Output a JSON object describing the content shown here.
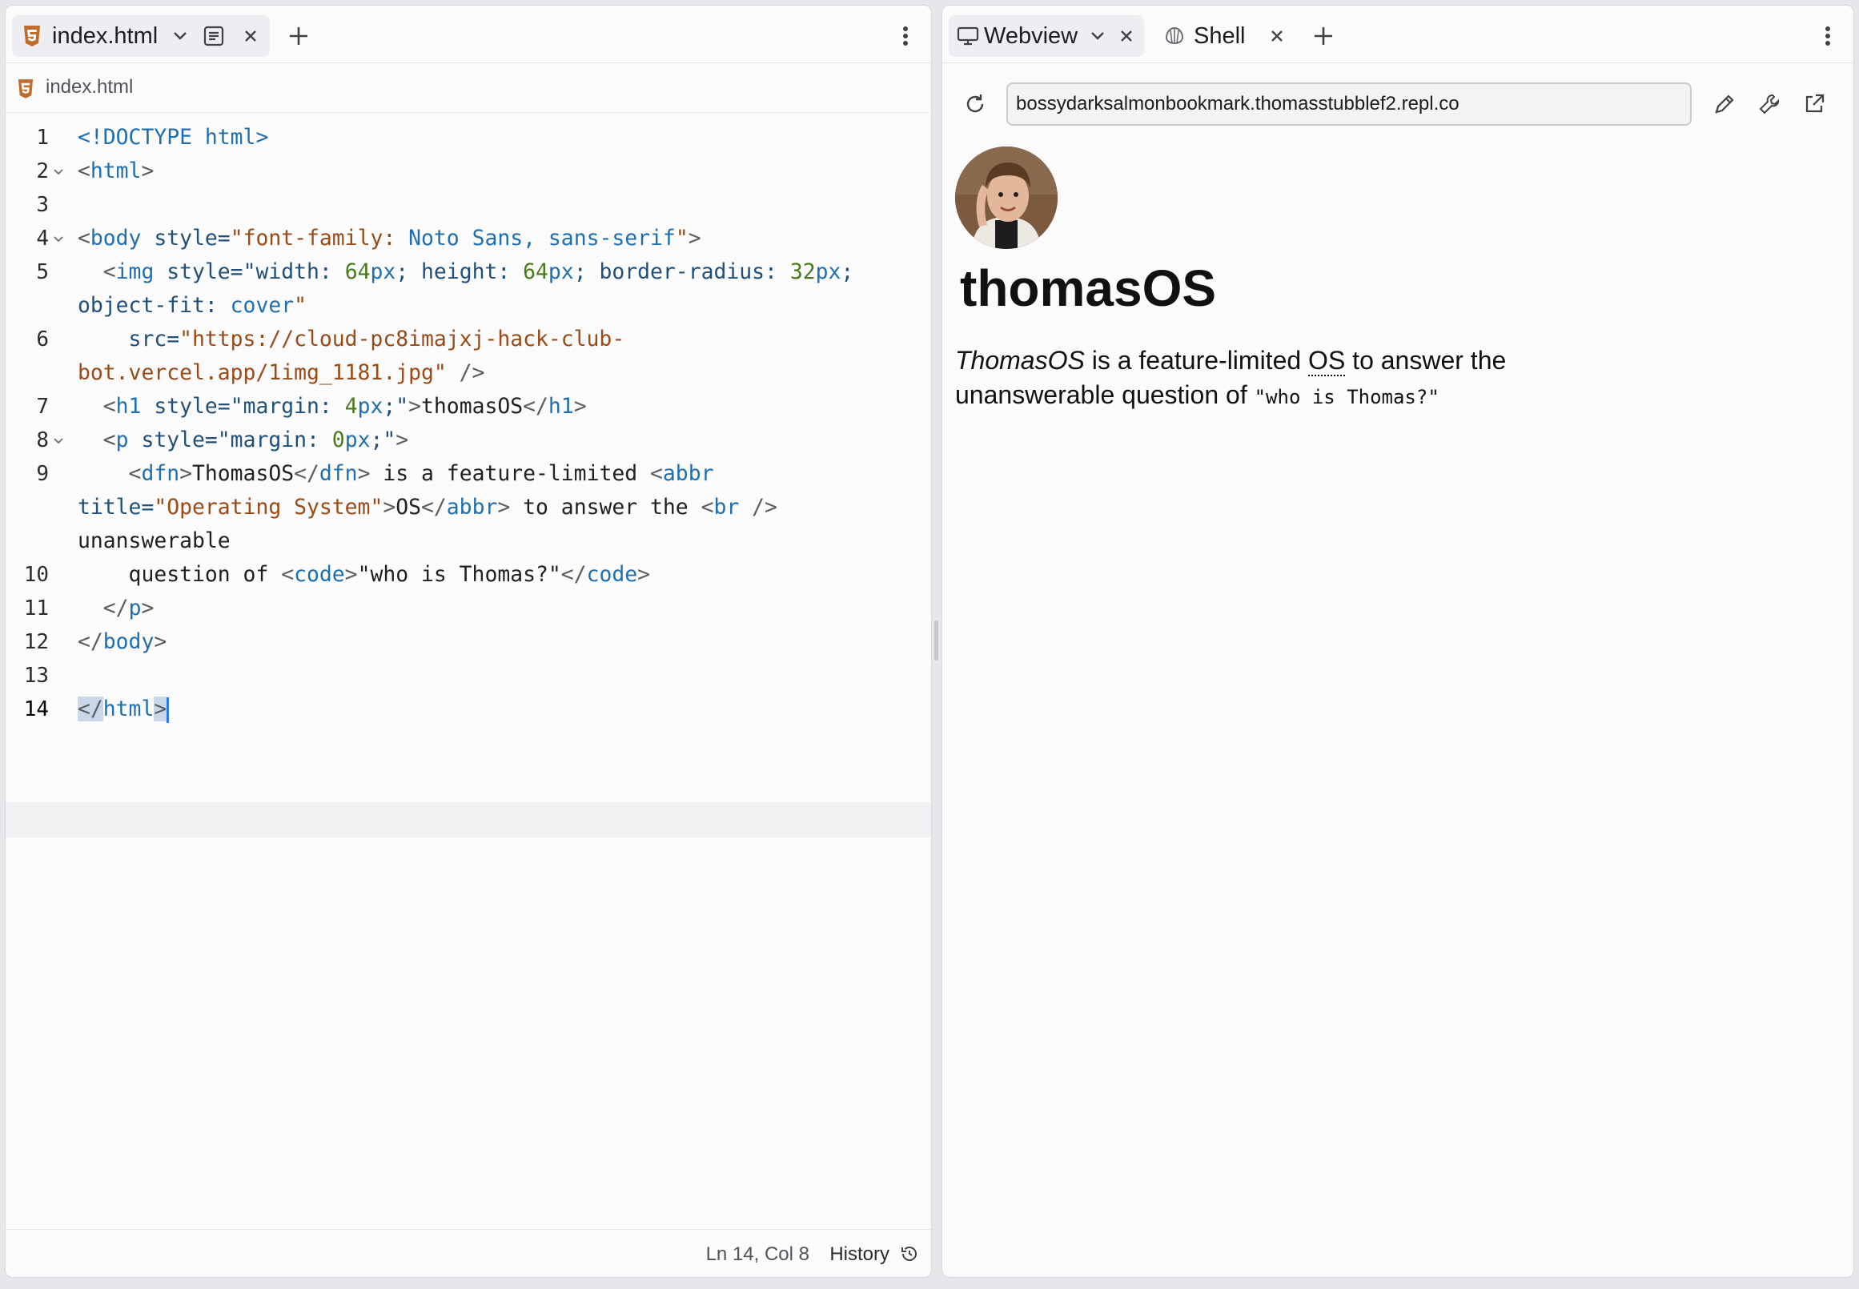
{
  "editor": {
    "tab_label": "index.html",
    "breadcrumb": "index.html",
    "lines": [
      {
        "num": "1"
      },
      {
        "num": "2"
      },
      {
        "num": "3"
      },
      {
        "num": "4"
      },
      {
        "num": "5"
      },
      {
        "num": "6"
      },
      {
        "num": "7"
      },
      {
        "num": "8"
      },
      {
        "num": "9"
      },
      {
        "num": "10"
      },
      {
        "num": "11"
      },
      {
        "num": "12"
      },
      {
        "num": "13"
      },
      {
        "num": "14"
      }
    ],
    "code": {
      "l1_doctype": "<!DOCTYPE html>",
      "l2_open": "<",
      "l2_tag": "html",
      "l2_close": ">",
      "l4_open": "<",
      "l4_tag": "body",
      "l4_attr": " style=",
      "l4_val_a": "\"font-family: ",
      "l4_val_b": "Noto Sans, ",
      "l4_val_c": "sans-serif",
      "l4_val_d": "\"",
      "l4_close": ">",
      "l5a_open": "  <",
      "l5a_tag": "img",
      "l5a_attr": " style=",
      "l5a_v1": "\"width: ",
      "l5a_n1": "64",
      "l5a_u1": "px",
      "l5a_v2": "; height: ",
      "l5a_n2": "64",
      "l5a_u2": "px",
      "l5a_v3": "; border-radius: ",
      "l5a_n3": "32",
      "l5a_u3": "px",
      "l5a_v4": ";",
      "l5b_v": "object-fit: ",
      "l5b_val": "cover",
      "l5b_q": "\"",
      "l6a_attr": "    src=",
      "l6a_val": "\"https://cloud-pc8imajxj-hack-club-",
      "l6b_val": "bot.vercel.app/1img_1181.jpg\"",
      "l6b_close": " />",
      "l7_open": "  <",
      "l7_tag": "h1",
      "l7_attr": " style=",
      "l7_v1": "\"margin: ",
      "l7_n1": "4",
      "l7_u1": "px",
      "l7_v2": ";\"",
      "l7_close": ">",
      "l7_text": "thomasOS",
      "l7_end_open": "</",
      "l7_end_tag": "h1",
      "l7_end_close": ">",
      "l8_open": "  <",
      "l8_tag": "p",
      "l8_attr": " style=",
      "l8_v1": "\"margin: ",
      "l8_n1": "0",
      "l8_u1": "px",
      "l8_v2": ";\"",
      "l8_close": ">",
      "l9a_open": "    <",
      "l9a_tag": "dfn",
      "l9a_close": ">",
      "l9a_text": "ThomasOS",
      "l9a_end_open": "</",
      "l9a_end_tag": "dfn",
      "l9a_end_close": ">",
      "l9a_text2": " is a feature-limited ",
      "l9a_abbr_open": "<",
      "l9a_abbr_tag": "abbr",
      "l9b_attr": "title=",
      "l9b_val": "\"Operating System\"",
      "l9b_close": ">",
      "l9b_text": "OS",
      "l9b_end_open": "</",
      "l9b_end_tag": "abbr",
      "l9b_end_close": ">",
      "l9b_text2": " to answer the ",
      "l9b_br_open": "<",
      "l9b_br_tag": "br",
      "l9b_br_close": " />",
      "l9c_text": "unanswerable",
      "l10_text": "    question of ",
      "l10_open": "<",
      "l10_tag": "code",
      "l10_close": ">",
      "l10_text2": "\"who is Thomas?\"",
      "l10_end_open": "</",
      "l10_end_tag": "code",
      "l10_end_close": ">",
      "l11_open": "  </",
      "l11_tag": "p",
      "l11_close": ">",
      "l12_open": "</",
      "l12_tag": "body",
      "l12_close": ">",
      "l14_open": "</",
      "l14_tag": "html",
      "l14_close": ">"
    },
    "status_position": "Ln 14, Col 8",
    "history_label": "History"
  },
  "webview": {
    "tab_webview": "Webview",
    "tab_shell": "Shell",
    "url": "bossydarksalmonbookmark.thomasstubblef2.repl.co",
    "page": {
      "heading": "thomasOS",
      "dfn": "ThomasOS",
      "text1": " is a feature-limited ",
      "abbr": "OS",
      "abbr_title": "Operating System",
      "text2": " to answer the",
      "text3": "unanswerable question of ",
      "code": "\"who is Thomas?\""
    }
  },
  "icons": [
    "html5-icon",
    "chevron-down-icon",
    "markdown-icon",
    "close-icon",
    "plus-icon",
    "more-vertical-icon",
    "monitor-icon",
    "shell-icon",
    "refresh-icon",
    "pencil-icon",
    "wrench-icon",
    "external-link-icon",
    "history-icon"
  ],
  "colors": {
    "accent": "#2a7ae2",
    "html_icon": "#c06a2b",
    "tag": "#1f6fb0",
    "string": "#9a4a17",
    "number": "#4a7a1c"
  }
}
